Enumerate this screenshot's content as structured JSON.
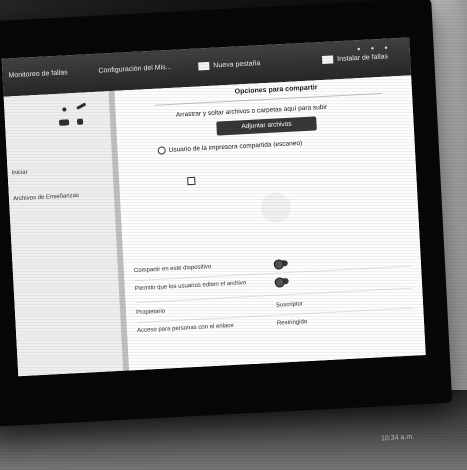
{
  "browser": {
    "tabs": [
      {
        "label": "Monitoreo de fallas",
        "icon": "page-icon"
      },
      {
        "label": "Configuración del Mis...",
        "icon": "page-icon"
      },
      {
        "label": "Nueva pestaña",
        "icon": "google-docs-icon"
      }
    ],
    "extra_label": "Instalar de fallas"
  },
  "left_pane": {
    "lines": [
      "Iniciar",
      "Archivos de Enseñanzas"
    ]
  },
  "dialog": {
    "title": "Opciones para compartir",
    "drop_text": "Arrastrar y soltar archivos o carpetas aquí para subir",
    "select_button": "Adjuntar archivos",
    "drive_option": "Usuario de la impresora compartida (escaneo)",
    "options": [
      {
        "label": "Compartir en este dispositivo",
        "type": "toggle"
      },
      {
        "label": "Permitir que los usuarios editen el archivo",
        "type": "toggle"
      },
      {
        "label": "Propietario",
        "value": "Suscriptor"
      },
      {
        "label": "Acceso para personas con el enlace",
        "value": "Restringido"
      }
    ]
  },
  "taskbar": {
    "clock": "10:34 a.m."
  }
}
